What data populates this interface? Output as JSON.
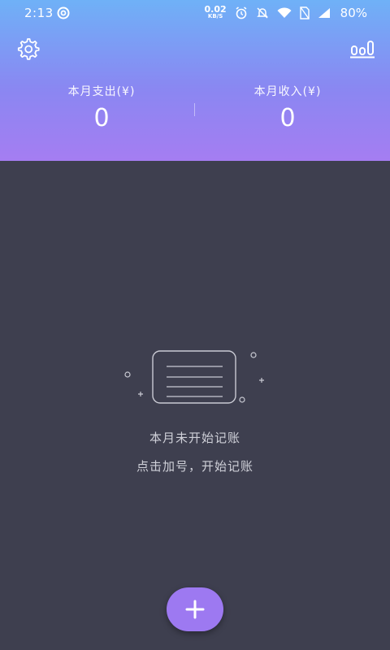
{
  "status_bar": {
    "time": "2:13",
    "net_speed_value": "0.02",
    "net_speed_unit": "KB/S",
    "battery": "80%",
    "icons": [
      "app-notification-icon",
      "alarm-icon",
      "mute-icon",
      "wifi-icon",
      "no-sim-icon",
      "signal-icon"
    ]
  },
  "toolbar": {
    "settings_icon": "gear-icon",
    "stats_icon": "bar-chart-icon"
  },
  "summary": {
    "expense_label": "本月支出(¥)",
    "expense_value": "0",
    "income_label": "本月收入(¥)",
    "income_value": "0"
  },
  "empty_state": {
    "icon": "empty-document-icon",
    "title": "本月未开始记账",
    "subtitle": "点击加号，开始记账"
  },
  "fab": {
    "icon": "plus-icon"
  },
  "colors": {
    "header_top": "#6fb1f7",
    "header_bottom": "#a57df2",
    "background": "#3e3f4f",
    "accent": "#9d79f1",
    "text_light": "#cfd0d8"
  }
}
